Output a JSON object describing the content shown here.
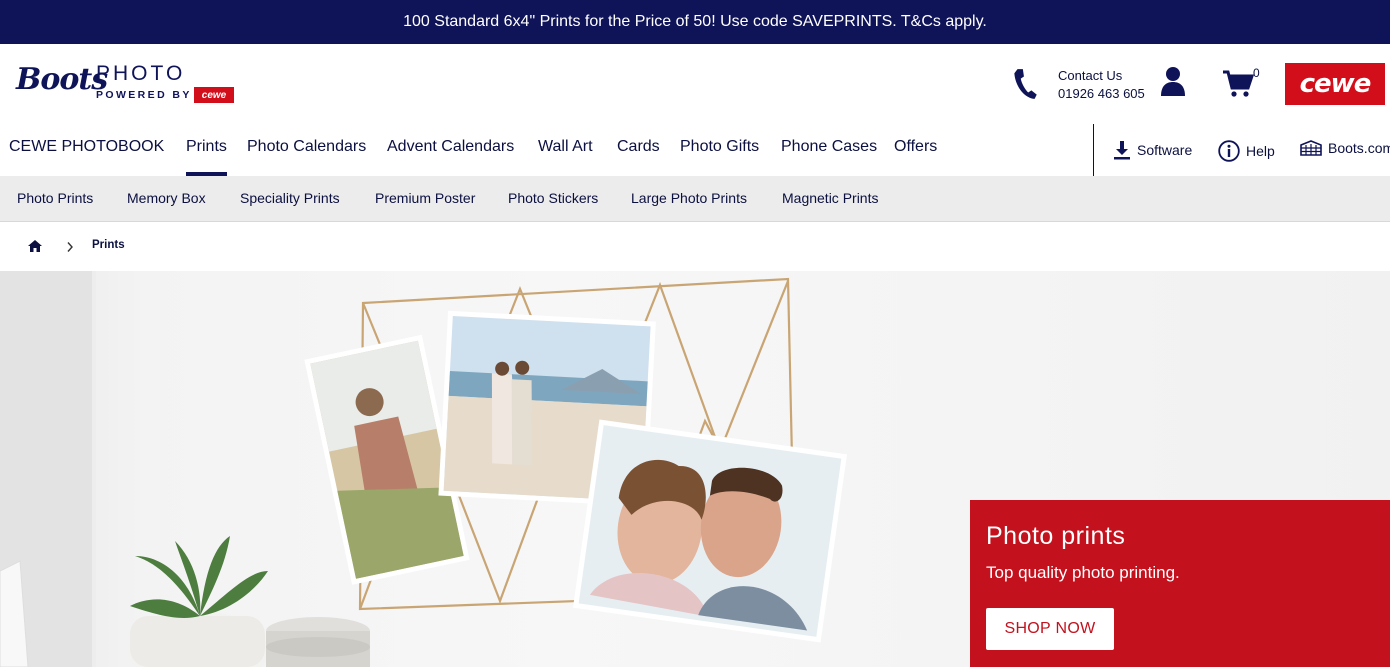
{
  "promo_bar": {
    "text": "100 Standard 6x4\" Prints for the Price of 50! Use code SAVEPRINTS. T&Cs apply."
  },
  "logo": {
    "brand": "Boots",
    "product": "PHOTO",
    "powered_by": "POWERED BY",
    "partner": "cewe"
  },
  "contact": {
    "label": "Contact Us",
    "phone": "01926 463 605"
  },
  "cart": {
    "count": "0"
  },
  "partner_logo": {
    "text": "cewe"
  },
  "main_nav": {
    "items": [
      {
        "label": "CEWE PHOTOBOOK"
      },
      {
        "label": "Prints",
        "active": true
      },
      {
        "label": "Photo Calendars"
      },
      {
        "label": "Advent Calendars"
      },
      {
        "label": "Wall Art"
      },
      {
        "label": "Cards"
      },
      {
        "label": "Photo Gifts"
      },
      {
        "label": "Phone Cases"
      },
      {
        "label": "Offers"
      }
    ],
    "utilities": [
      {
        "label": "Software",
        "icon": "download-icon"
      },
      {
        "label": "Help",
        "icon": "info-icon"
      },
      {
        "label": "Boots.com",
        "icon": "store-icon"
      }
    ]
  },
  "sub_nav": {
    "items": [
      {
        "label": "Photo Prints"
      },
      {
        "label": "Memory Box"
      },
      {
        "label": "Speciality Prints"
      },
      {
        "label": "Premium Poster"
      },
      {
        "label": "Photo Stickers"
      },
      {
        "label": "Large Photo Prints"
      },
      {
        "label": "Magnetic Prints"
      }
    ]
  },
  "breadcrumb": {
    "current": "Prints"
  },
  "hero": {
    "title": "Photo prints",
    "subtitle": "Top quality photo printing.",
    "cta": "SHOP NOW"
  },
  "colors": {
    "navy": "#0f1358",
    "red": "#c3111d"
  }
}
